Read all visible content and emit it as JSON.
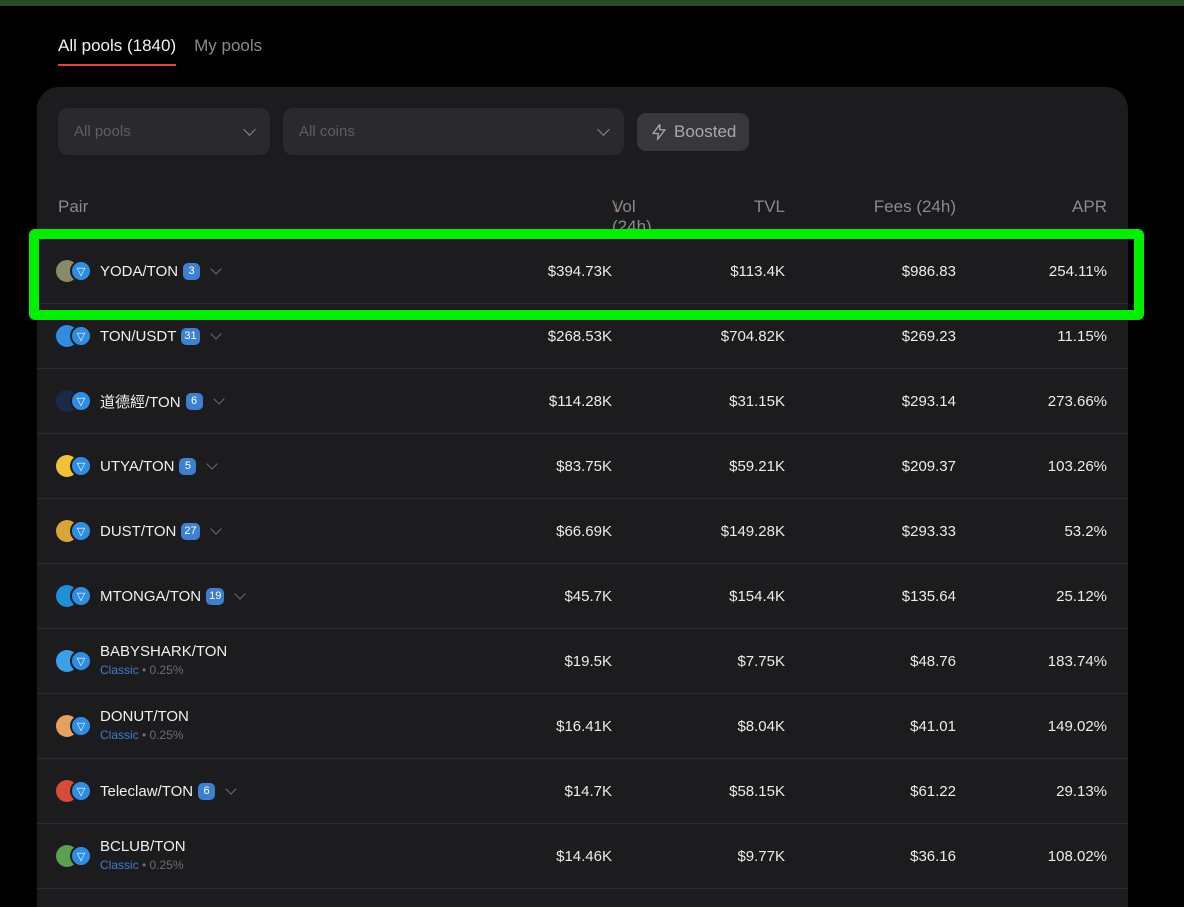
{
  "tabs": [
    {
      "label": "All pools (1840)",
      "active": true
    },
    {
      "label": "My pools",
      "active": false
    }
  ],
  "filters": {
    "pools_placeholder": "All pools",
    "coins_placeholder": "All coins",
    "boosted_label": "Boosted"
  },
  "table": {
    "headers": {
      "pair": "Pair",
      "vol": "Vol (24h)",
      "tvl": "TVL",
      "fees": "Fees (24h)",
      "apr": "APR"
    },
    "rows": [
      {
        "pair": "YODA/TON",
        "badge": "3",
        "sub": null,
        "vol": "$394.73K",
        "tvl": "$113.4K",
        "fees": "$986.83",
        "apr": "254.11%",
        "icon_color": "#8a8a6a",
        "highlighted": true
      },
      {
        "pair": "TON/USDT",
        "badge": "31",
        "sub": null,
        "vol": "$268.53K",
        "tvl": "$704.82K",
        "fees": "$269.23",
        "apr": "11.15%",
        "icon_color": "#2f8de4"
      },
      {
        "pair": "道德經/TON",
        "badge": "6",
        "sub": null,
        "vol": "$114.28K",
        "tvl": "$31.15K",
        "fees": "$293.14",
        "apr": "273.66%",
        "icon_color": "#1a2a4a"
      },
      {
        "pair": "UTYA/TON",
        "badge": "5",
        "sub": null,
        "vol": "$83.75K",
        "tvl": "$59.21K",
        "fees": "$209.37",
        "apr": "103.26%",
        "icon_color": "#f0c23a"
      },
      {
        "pair": "DUST/TON",
        "badge": "27",
        "sub": null,
        "vol": "$66.69K",
        "tvl": "$149.28K",
        "fees": "$293.33",
        "apr": "53.2%",
        "icon_color": "#d9a53a"
      },
      {
        "pair": "MTONGA/TON",
        "badge": "19",
        "sub": null,
        "vol": "$45.7K",
        "tvl": "$154.4K",
        "fees": "$135.64",
        "apr": "25.12%",
        "icon_color": "#1e8fd8"
      },
      {
        "pair": "BABYSHARK/TON",
        "badge": null,
        "sub": {
          "type": "Classic",
          "fee": "0.25%"
        },
        "vol": "$19.5K",
        "tvl": "$7.75K",
        "fees": "$48.76",
        "apr": "183.74%",
        "icon_color": "#3aa0e8"
      },
      {
        "pair": "DONUT/TON",
        "badge": null,
        "sub": {
          "type": "Classic",
          "fee": "0.25%"
        },
        "vol": "$16.41K",
        "tvl": "$8.04K",
        "fees": "$41.01",
        "apr": "149.02%",
        "icon_color": "#e8a060"
      },
      {
        "pair": "Teleclaw/TON",
        "badge": "6",
        "sub": null,
        "vol": "$14.7K",
        "tvl": "$58.15K",
        "fees": "$61.22",
        "apr": "29.13%",
        "icon_color": "#d84a3a"
      },
      {
        "pair": "BCLUB/TON",
        "badge": null,
        "sub": {
          "type": "Classic",
          "fee": "0.25%"
        },
        "vol": "$14.46K",
        "tvl": "$9.77K",
        "fees": "$36.16",
        "apr": "108.02%",
        "icon_color": "#5aa050"
      }
    ]
  },
  "colors": {
    "accent_red": "#e0473b",
    "highlight_green": "#00f000",
    "badge_blue": "#3f7fd0"
  }
}
